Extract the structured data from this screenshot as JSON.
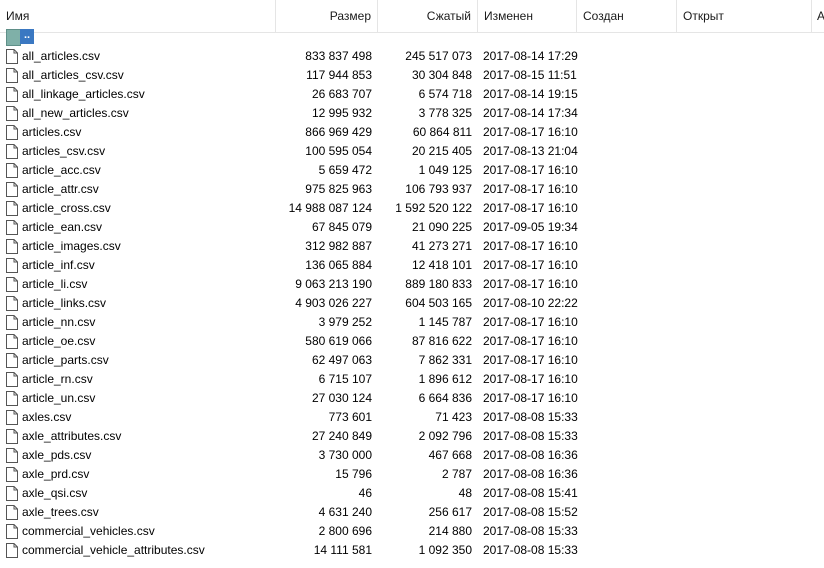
{
  "columns": {
    "name": "Имя",
    "size": "Размер",
    "compressed": "Сжатый",
    "modified": "Изменен",
    "created": "Создан",
    "opened": "Открыт",
    "attributes": "A"
  },
  "parent_dir": {
    "label": ".."
  },
  "files": [
    {
      "name": "all_articles.csv",
      "size": "833 837 498",
      "compressed": "245 517 073",
      "modified": "2017-08-14 17:29"
    },
    {
      "name": "all_articles_csv.csv",
      "size": "117 944 853",
      "compressed": "30 304 848",
      "modified": "2017-08-15 11:51"
    },
    {
      "name": "all_linkage_articles.csv",
      "size": "26 683 707",
      "compressed": "6 574 718",
      "modified": "2017-08-14 19:15"
    },
    {
      "name": "all_new_articles.csv",
      "size": "12 995 932",
      "compressed": "3 778 325",
      "modified": "2017-08-14 17:34"
    },
    {
      "name": "articles.csv",
      "size": "866 969 429",
      "compressed": "60 864 811",
      "modified": "2017-08-17 16:10"
    },
    {
      "name": "articles_csv.csv",
      "size": "100 595 054",
      "compressed": "20 215 405",
      "modified": "2017-08-13 21:04"
    },
    {
      "name": "article_acc.csv",
      "size": "5 659 472",
      "compressed": "1 049 125",
      "modified": "2017-08-17 16:10"
    },
    {
      "name": "article_attr.csv",
      "size": "975 825 963",
      "compressed": "106 793 937",
      "modified": "2017-08-17 16:10"
    },
    {
      "name": "article_cross.csv",
      "size": "14 988 087 124",
      "compressed": "1 592 520 122",
      "modified": "2017-08-17 16:10"
    },
    {
      "name": "article_ean.csv",
      "size": "67 845 079",
      "compressed": "21 090 225",
      "modified": "2017-09-05 19:34"
    },
    {
      "name": "article_images.csv",
      "size": "312 982 887",
      "compressed": "41 273 271",
      "modified": "2017-08-17 16:10"
    },
    {
      "name": "article_inf.csv",
      "size": "136 065 884",
      "compressed": "12 418 101",
      "modified": "2017-08-17 16:10"
    },
    {
      "name": "article_li.csv",
      "size": "9 063 213 190",
      "compressed": "889 180 833",
      "modified": "2017-08-17 16:10"
    },
    {
      "name": "article_links.csv",
      "size": "4 903 026 227",
      "compressed": "604 503 165",
      "modified": "2017-08-10 22:22"
    },
    {
      "name": "article_nn.csv",
      "size": "3 979 252",
      "compressed": "1 145 787",
      "modified": "2017-08-17 16:10"
    },
    {
      "name": "article_oe.csv",
      "size": "580 619 066",
      "compressed": "87 816 622",
      "modified": "2017-08-17 16:10"
    },
    {
      "name": "article_parts.csv",
      "size": "62 497 063",
      "compressed": "7 862 331",
      "modified": "2017-08-17 16:10"
    },
    {
      "name": "article_rn.csv",
      "size": "6 715 107",
      "compressed": "1 896 612",
      "modified": "2017-08-17 16:10"
    },
    {
      "name": "article_un.csv",
      "size": "27 030 124",
      "compressed": "6 664 836",
      "modified": "2017-08-17 16:10"
    },
    {
      "name": "axles.csv",
      "size": "773 601",
      "compressed": "71 423",
      "modified": "2017-08-08 15:33"
    },
    {
      "name": "axle_attributes.csv",
      "size": "27 240 849",
      "compressed": "2 092 796",
      "modified": "2017-08-08 15:33"
    },
    {
      "name": "axle_pds.csv",
      "size": "3 730 000",
      "compressed": "467 668",
      "modified": "2017-08-08 16:36"
    },
    {
      "name": "axle_prd.csv",
      "size": "15 796",
      "compressed": "2 787",
      "modified": "2017-08-08 16:36"
    },
    {
      "name": "axle_qsi.csv",
      "size": "46",
      "compressed": "48",
      "modified": "2017-08-08 15:41"
    },
    {
      "name": "axle_trees.csv",
      "size": "4 631 240",
      "compressed": "256 617",
      "modified": "2017-08-08 15:52"
    },
    {
      "name": "commercial_vehicles.csv",
      "size": "2 800 696",
      "compressed": "214 880",
      "modified": "2017-08-08 15:33"
    },
    {
      "name": "commercial_vehicle_attributes.csv",
      "size": "14 111 581",
      "compressed": "1 092 350",
      "modified": "2017-08-08 15:33"
    }
  ]
}
